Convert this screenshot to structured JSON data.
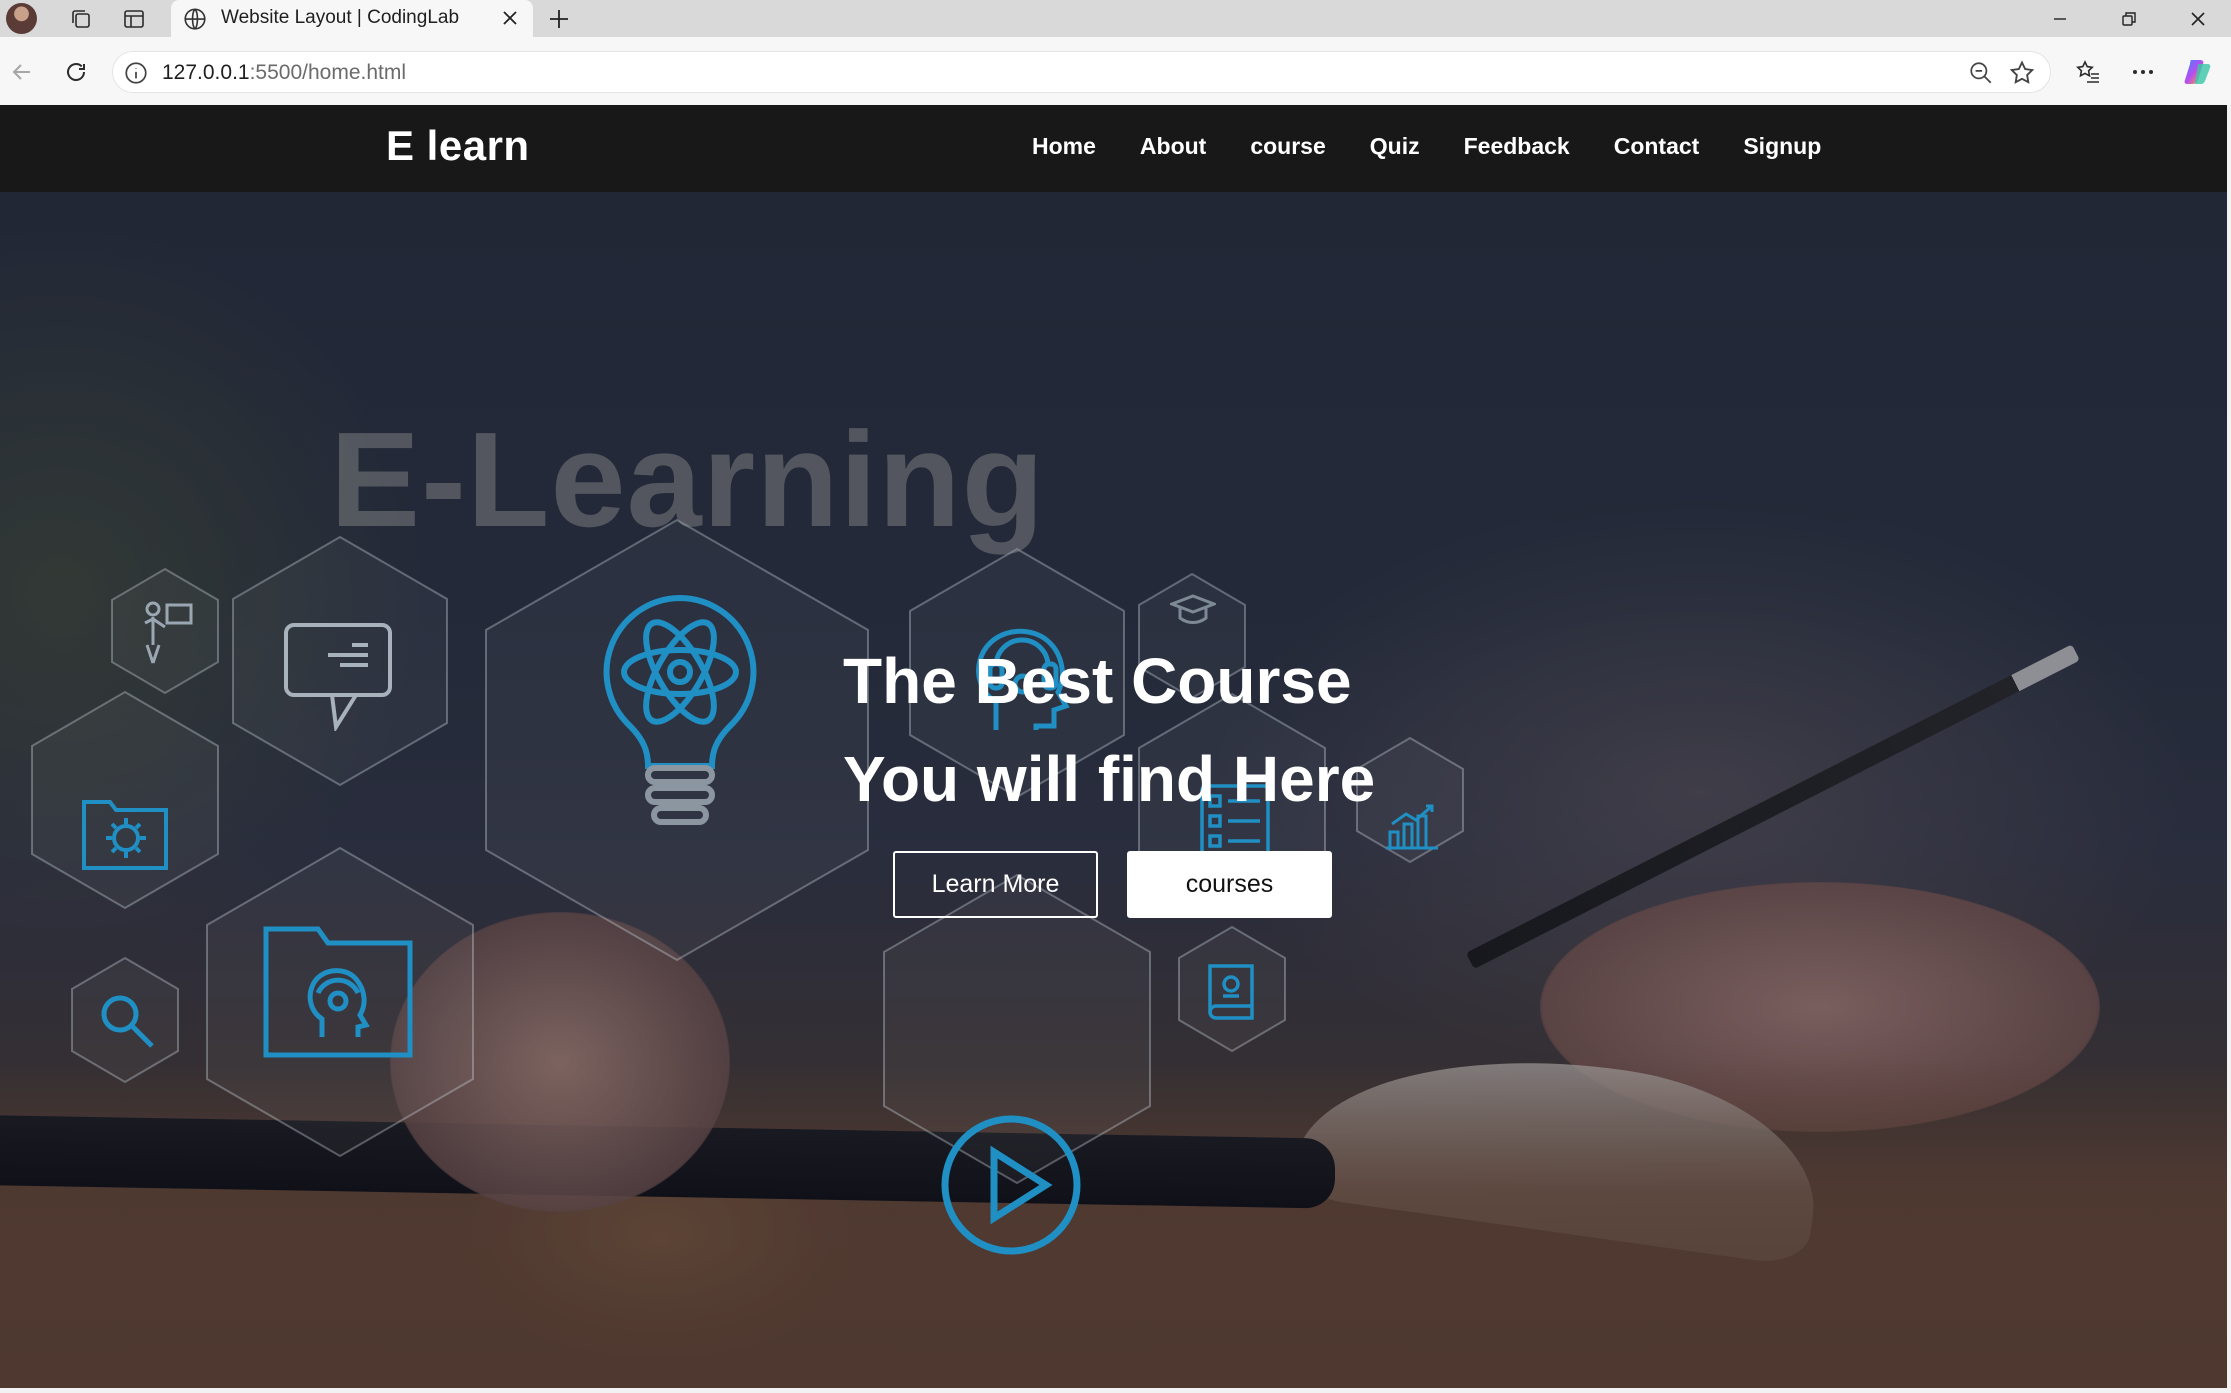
{
  "browser": {
    "tab_title": "Website Layout | CodingLab",
    "url_host": "127.0.0.1",
    "url_path": ":5500/home.html"
  },
  "nav": {
    "logo": "E learn",
    "items": [
      {
        "label": "Home"
      },
      {
        "label": "About"
      },
      {
        "label": "course"
      },
      {
        "label": "Quiz"
      },
      {
        "label": "Feedback"
      },
      {
        "label": "Contact"
      },
      {
        "label": "Signup"
      }
    ]
  },
  "hero": {
    "watermark": "E-Learning",
    "headline_line1": "The Best Course",
    "headline_line2": "You will find Here",
    "btn_learn_more": "Learn More",
    "btn_courses": "courses"
  },
  "colors": {
    "navbar_bg": "#181818",
    "icon_accent": "#1f8fc4",
    "text": "#ffffff"
  },
  "icons": [
    "teacher-icon",
    "chat-icon",
    "lightbulb-atom-icon",
    "head-headset-icon",
    "graduation-cap-icon",
    "folder-gear-icon",
    "checklist-icon",
    "bar-chart-icon",
    "search-icon",
    "folder-head-icon",
    "play-icon",
    "book-icon"
  ]
}
